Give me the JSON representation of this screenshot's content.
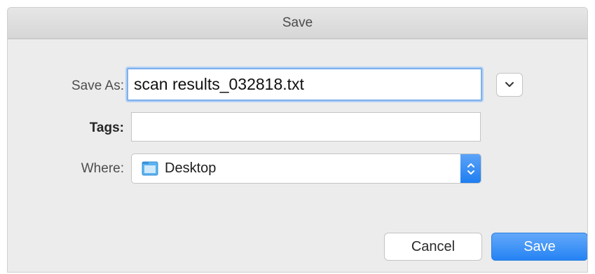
{
  "dialog": {
    "title": "Save"
  },
  "form": {
    "save_as_label": "Save As:",
    "save_as_value": "scan results_032818.txt",
    "tags_label": "Tags:",
    "tags_value": "",
    "where_label": "Where:",
    "where_value": "Desktop"
  },
  "buttons": {
    "cancel_label": "Cancel",
    "save_label": "Save"
  },
  "icons": {
    "expand": "chevron-down-icon",
    "folder": "folder-icon",
    "stepper": "up-down-chevron-icon"
  },
  "colors": {
    "accent": "#2583f3",
    "focus_ring": "#7fb0ea",
    "folder": "#5ab2f0"
  }
}
